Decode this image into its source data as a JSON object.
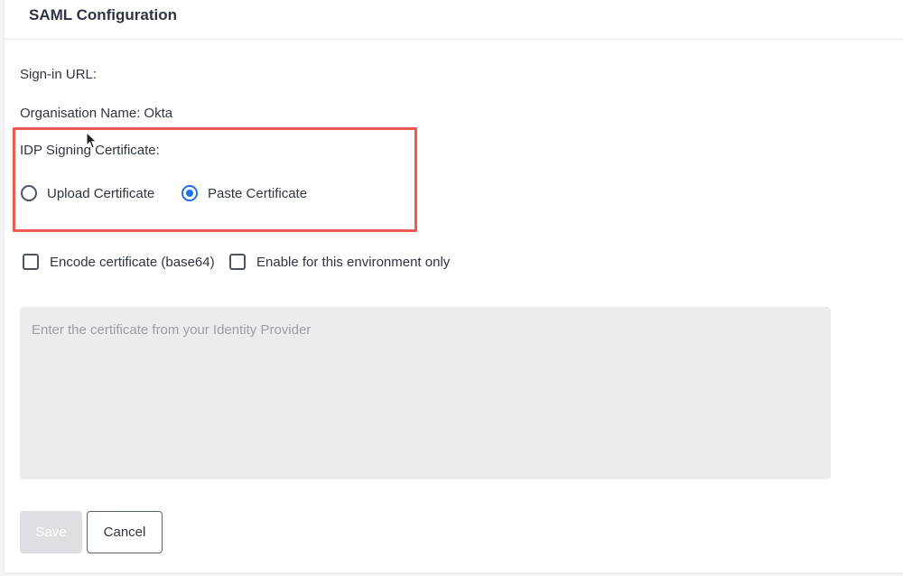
{
  "header": {
    "title": "SAML Configuration"
  },
  "fields": {
    "sign_in_url_label": "Sign-in URL:",
    "organisation_label": "Organisation Name:",
    "organisation_value": "Okta",
    "idp_cert_label": "IDP Signing Certificate:"
  },
  "cert_source": {
    "options": [
      {
        "label": "Upload Certificate",
        "checked": false
      },
      {
        "label": "Paste Certificate",
        "checked": true
      }
    ]
  },
  "checkboxes": {
    "encode_label": "Encode certificate (base64)",
    "encode_checked": false,
    "env_only_label": "Enable for this environment only",
    "env_only_checked": false
  },
  "certificate_input": {
    "value": "",
    "placeholder": "Enter the certificate from your Identity Provider"
  },
  "actions": {
    "save_label": "Save",
    "save_disabled": true,
    "cancel_label": "Cancel"
  },
  "colors": {
    "accent": "#1f6fe5",
    "highlight_border": "#ef5b4f",
    "disabled_button": "#dedfe2",
    "textarea_bg": "#ebecee"
  },
  "icons": {
    "cursor": "mouse-pointer-icon"
  }
}
